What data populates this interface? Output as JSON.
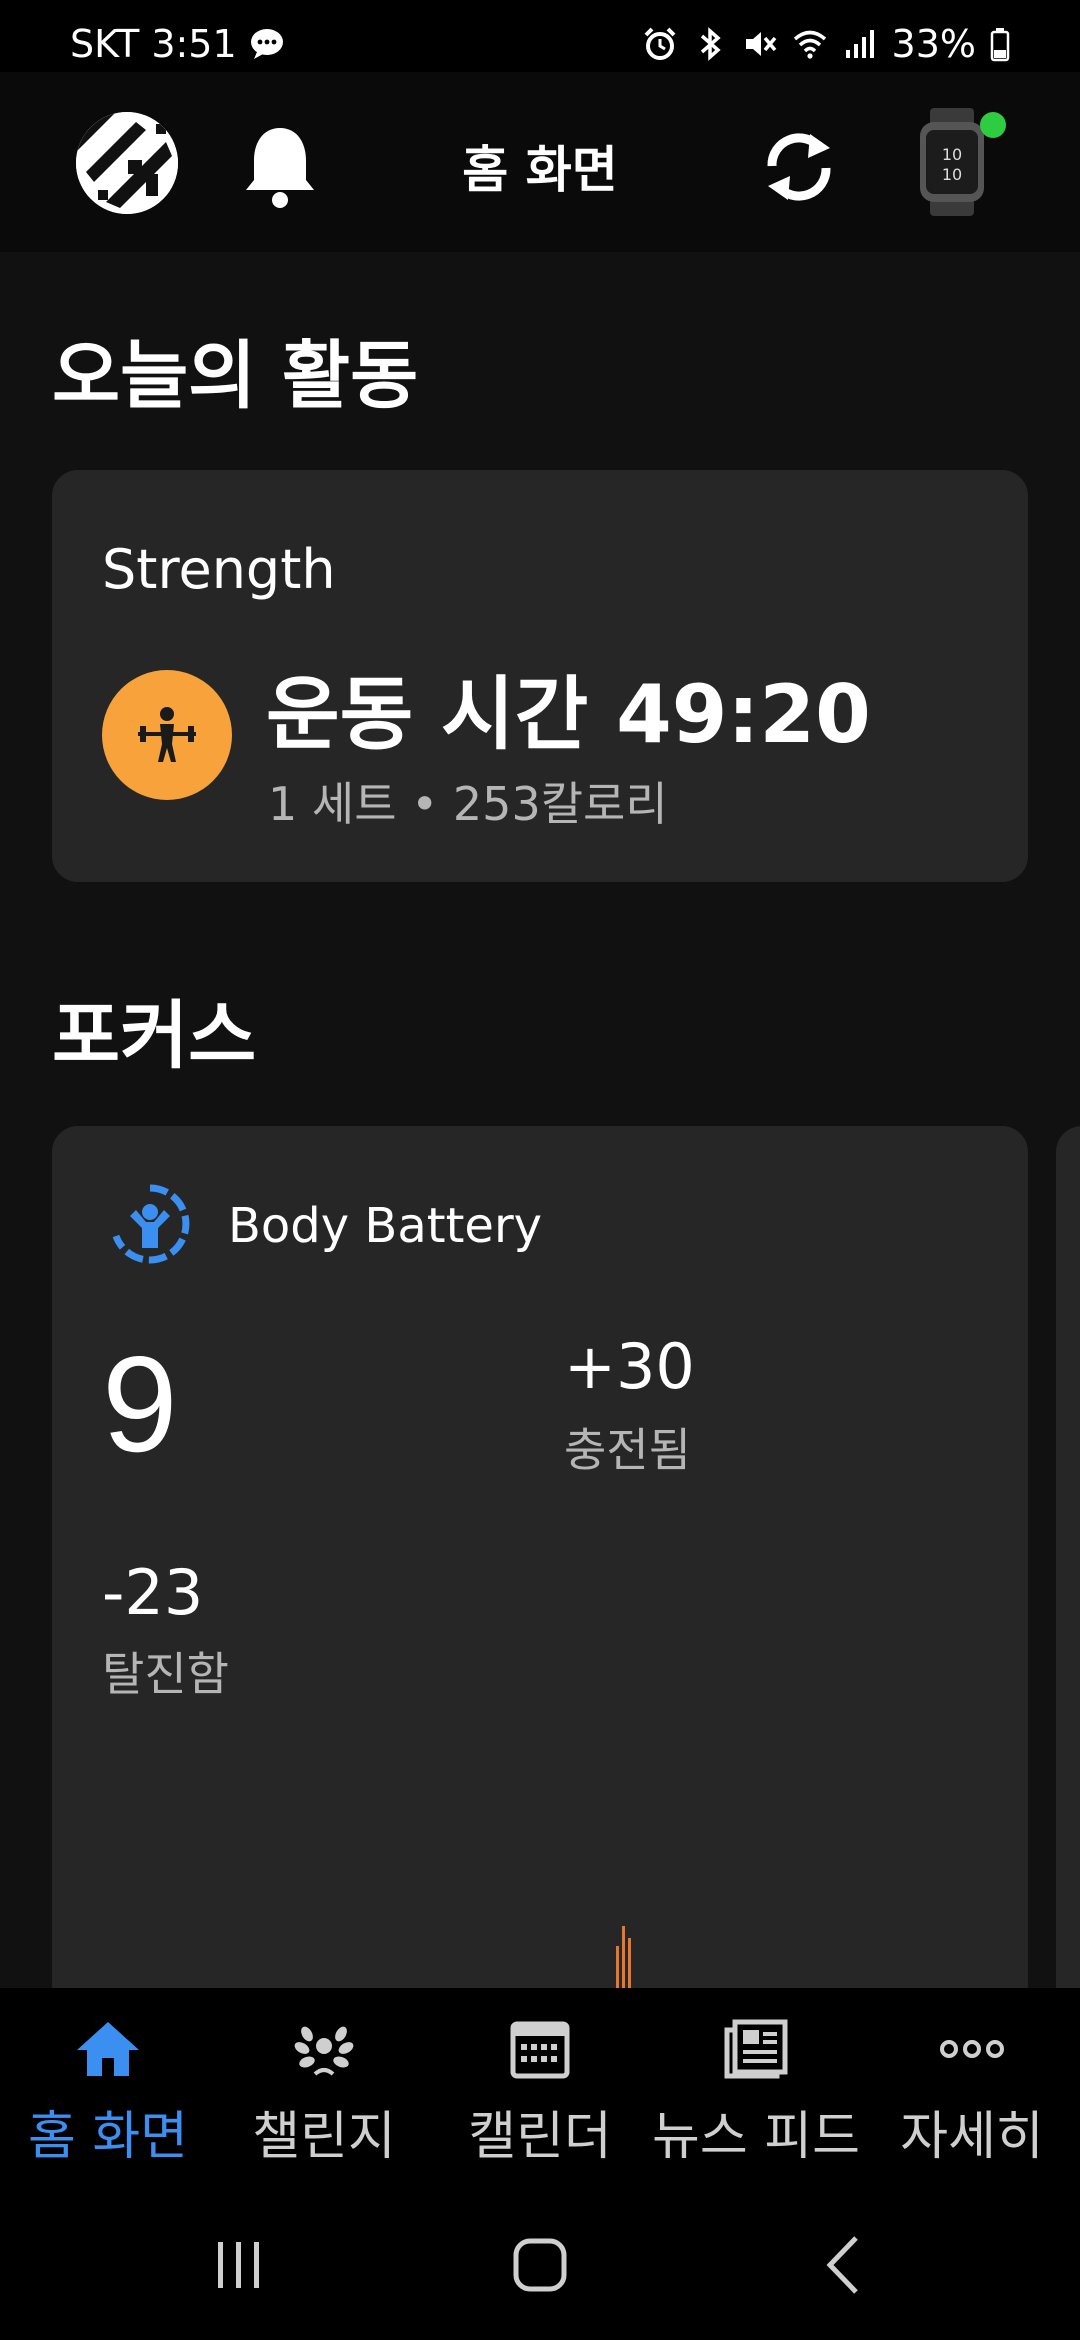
{
  "status_bar": {
    "carrier": "SKT",
    "time": "3:51",
    "battery": "33%",
    "icons": [
      "message-icon",
      "alarm-icon",
      "bluetooth-icon",
      "mute-icon",
      "wifi-icon",
      "signal-icon",
      "battery-icon"
    ]
  },
  "header": {
    "title": "홈 화면",
    "icons": [
      "avatar",
      "bell-icon",
      "sync-icon",
      "watch-icon"
    ],
    "watch_status_color": "#2ecc40"
  },
  "today": {
    "section_title": "오늘의 활동",
    "activity_type": "Strength",
    "main": "운동 시간 49:20",
    "sub": "1 세트 • 253칼로리",
    "icon": "weightlifting-icon",
    "icon_color": "#f7a23a"
  },
  "focus": {
    "section_title": "포커스",
    "body_battery": {
      "title": "Body Battery",
      "level": "9",
      "charged_value": "+30",
      "charged_label": "충전됨",
      "drained_value": "-23",
      "drained_label": "탈진함",
      "icon": "body-battery-icon",
      "icon_color": "#3b8ff0",
      "chart_color": "#e8762c"
    }
  },
  "bottom_nav": {
    "items": [
      {
        "label": "홈 화면",
        "icon": "home-icon",
        "active": true
      },
      {
        "label": "챌린지",
        "icon": "laurel-icon",
        "active": false
      },
      {
        "label": "캘린더",
        "icon": "calendar-icon",
        "active": false
      },
      {
        "label": "뉴스 피드",
        "icon": "news-icon",
        "active": false
      },
      {
        "label": "자세히",
        "icon": "more-icon",
        "active": false
      }
    ],
    "active_color": "#3b8ff0"
  },
  "system_nav": [
    "recent-apps-icon",
    "home-button-icon",
    "back-icon"
  ]
}
